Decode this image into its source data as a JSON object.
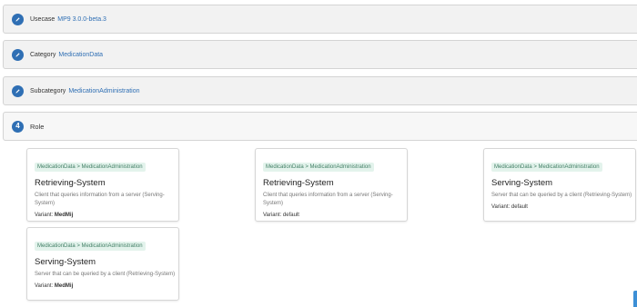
{
  "steps": [
    {
      "label": "Usecase",
      "value": "MP9 3.0.0-beta.3"
    },
    {
      "label": "Category",
      "value": "MedicationData"
    },
    {
      "label": "Subcategory",
      "value": "MedicationAdministration"
    },
    {
      "number": "4",
      "label": "Role"
    }
  ],
  "variant_prefix": "Variant:",
  "cards": [
    {
      "tag": "MedicationData > MedicationAdministration",
      "title": "Retrieving-System",
      "description": "Client that queries information from a server (Serving-System)",
      "variant": "MedMij"
    },
    {
      "tag": "MedicationData > MedicationAdministration",
      "title": "Retrieving-System",
      "description": "Client that queries information from a server (Serving-System)",
      "variant": "default"
    },
    {
      "tag": "MedicationData > MedicationAdministration",
      "title": "Serving-System",
      "description": "Server that can be queried by a client (Retrieving-System)",
      "variant": "default"
    },
    {
      "tag": "MedicationData > MedicationAdministration",
      "title": "Serving-System",
      "description": "Server that can be queried by a client (Retrieving-System)",
      "variant": "MedMij"
    }
  ],
  "colors": {
    "accent": "#2f6fb4",
    "tag_bg": "#e3f3ec",
    "tag_text": "#3f7d63"
  }
}
